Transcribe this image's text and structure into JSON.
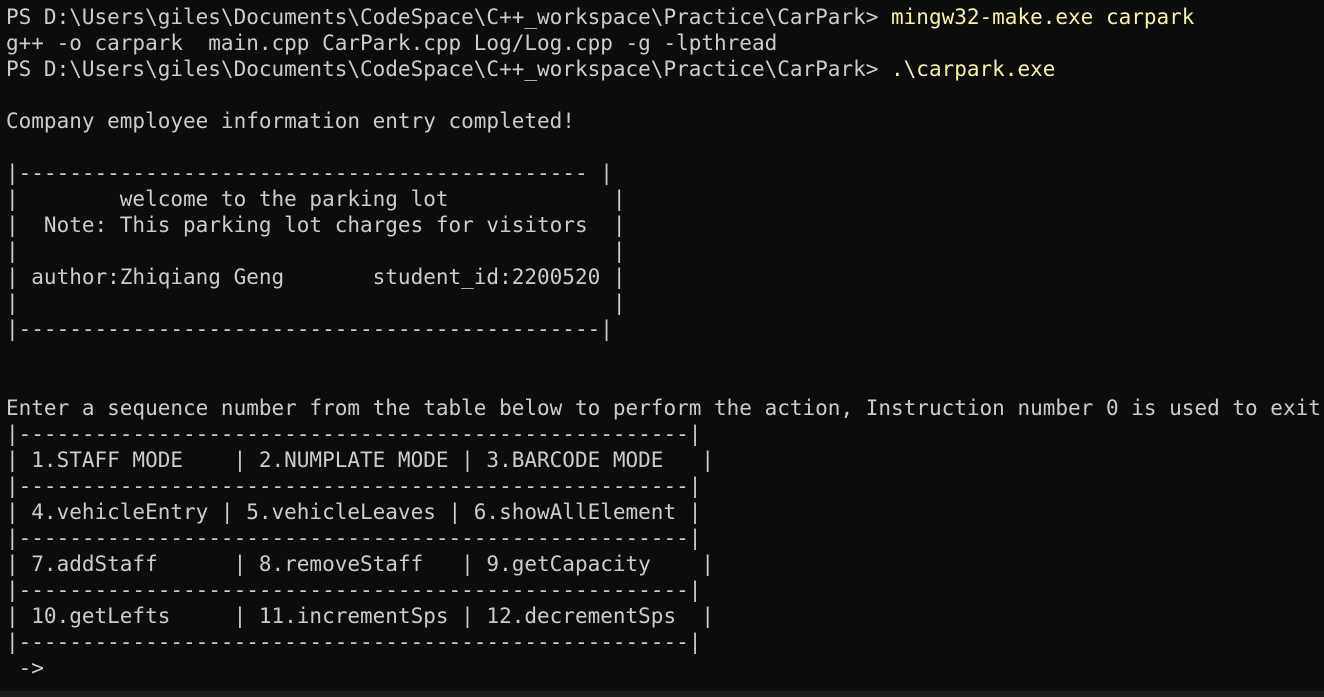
{
  "terminal": {
    "prompt": "PS D:\\Users\\giles\\Documents\\CodeSpace\\C++_workspace\\Practice\\CarPark> ",
    "cmd1": "mingw32-make.exe carpark",
    "build_output": "g++ -o carpark  main.cpp CarPark.cpp Log/Log.cpp -g -lpthread",
    "cmd2": ".\\carpark.exe",
    "entry_completed": "Company employee information entry completed!",
    "banner": {
      "border_top": "|--------------------------------------------- |",
      "welcome": "|        welcome to the parking lot             |",
      "note": "|  Note: This parking lot charges for visitors  |",
      "blank1": "|                                               |",
      "author": "| author:Zhiqiang Geng       student_id:2200520 |",
      "blank2": "|                                               |",
      "border_bottom": "|----------------------------------------------|"
    },
    "instruction": "Enter a sequence number from the table below to perform the action, Instruction number 0 is used to exit",
    "menu": {
      "sep1": "|-----------------------------------------------------|",
      "row1": "| 1.STAFF MODE    | 2.NUMPLATE MODE | 3.BARCODE MODE   |",
      "sep2": "|-----------------------------------------------------|",
      "row2": "| 4.vehicleEntry | 5.vehicleLeaves | 6.showAllElement |",
      "sep3": "|-----------------------------------------------------|",
      "row3": "| 7.addStaff      | 8.removeStaff   | 9.getCapacity    |",
      "sep4": "|-----------------------------------------------------|",
      "row4": "| 10.getLefts     | 11.incrementSps | 12.decrementSps  |",
      "sep5": "|-----------------------------------------------------|"
    },
    "input_prompt": " ->"
  }
}
